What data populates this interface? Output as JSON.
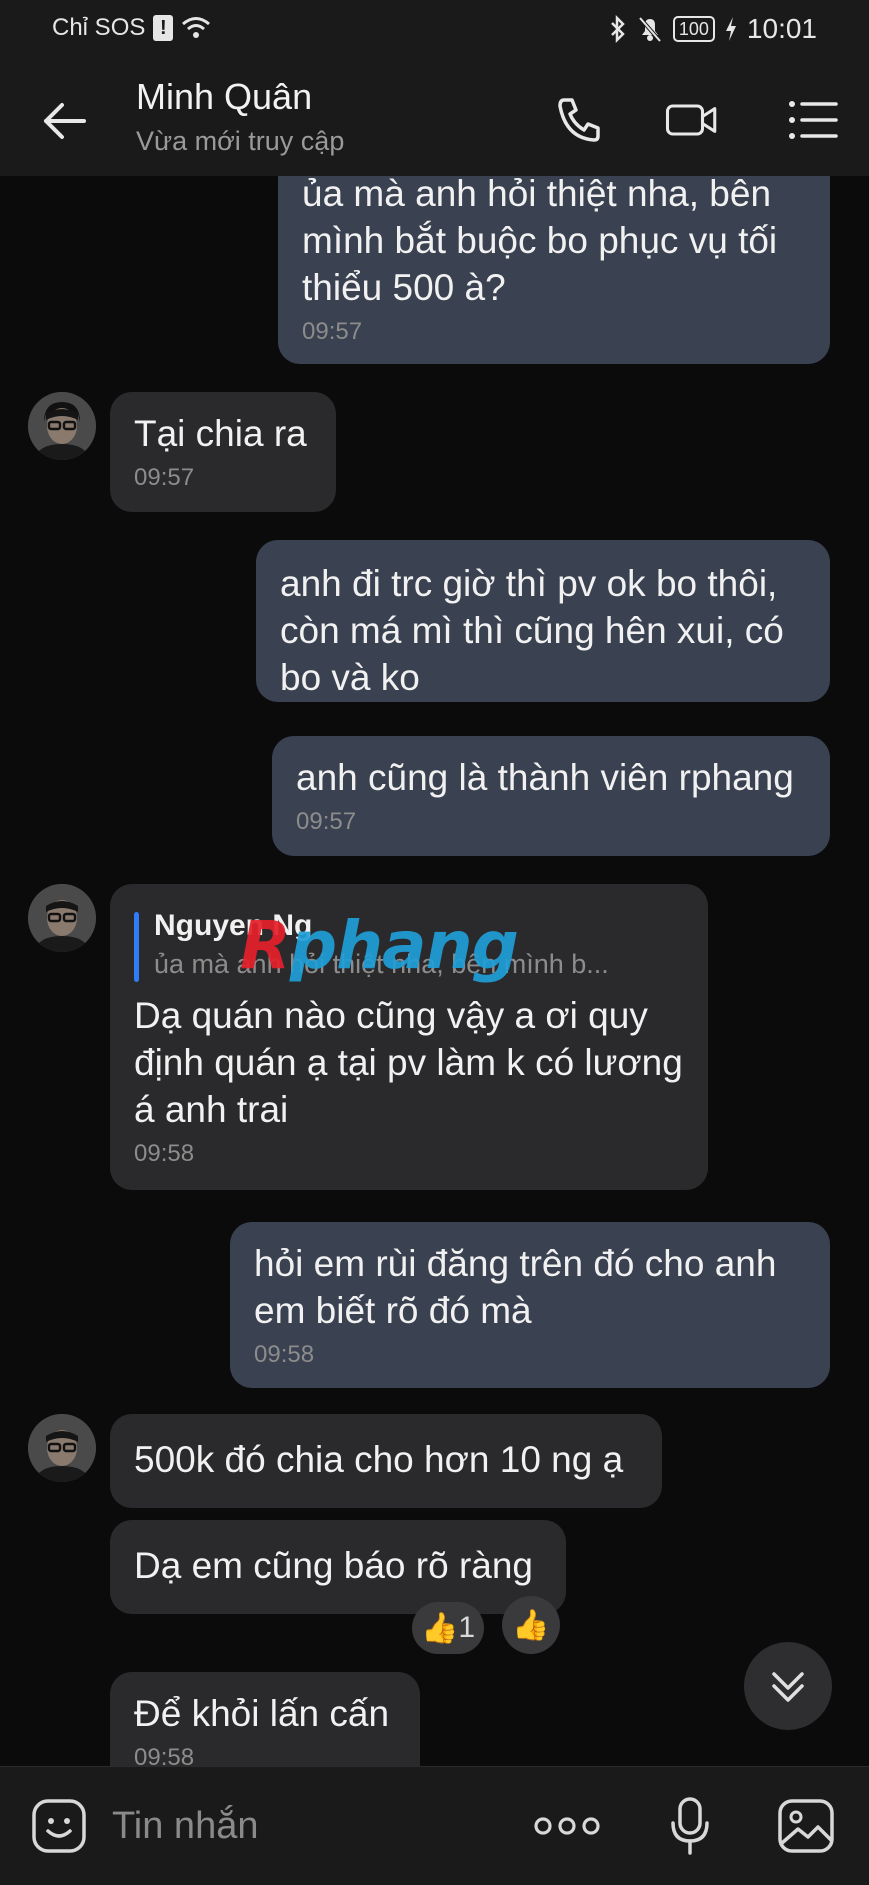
{
  "status_bar": {
    "carrier": "Chỉ SOS",
    "sos_mark": "!",
    "battery": "100",
    "time": "10:01"
  },
  "header": {
    "name": "Minh Quân",
    "status": "Vừa mới truy cập"
  },
  "messages": [
    {
      "dir": "out",
      "text": "ủa mà anh hỏi thiệt nha, bên mình bắt buộc bo phục vụ tối thiểu 500 à?",
      "time": "09:57"
    },
    {
      "dir": "in",
      "text": "Tại chia ra",
      "time": "09:57"
    },
    {
      "dir": "out",
      "text": "anh đi trc giờ thì pv ok bo thôi, còn má mì thì cũng hên xui, có bo và ko"
    },
    {
      "dir": "out",
      "text": "anh cũng là thành viên rphang",
      "time": "09:57"
    },
    {
      "dir": "in",
      "quote_name": "Nguyen Ng",
      "quote_text": "ủa mà anh hỏi thiệt nha, bên mình b...",
      "text": "Dạ quán nào cũng vậy a ơi quy định quán ạ tại pv làm k có lương á anh trai",
      "time": "09:58"
    },
    {
      "dir": "out",
      "text": "hỏi em rùi đăng trên đó cho anh em biết rõ đó mà",
      "time": "09:58"
    },
    {
      "dir": "in",
      "text": "500k đó chia cho hơn 10 ng ạ"
    },
    {
      "dir": "in",
      "text": "Dạ em cũng báo rõ ràng"
    },
    {
      "dir": "in",
      "text": "Để khỏi lấn cấn",
      "time": "09:58"
    }
  ],
  "reactions": [
    {
      "emoji": "👍",
      "count": "1"
    },
    {
      "emoji": "👍",
      "count": ""
    }
  ],
  "watermark": {
    "r": "R",
    "rest": "phang",
    "r_color": "#e5202a",
    "rest_color": "#1f9fd8"
  },
  "composer": {
    "placeholder": "Tin nhắn"
  },
  "colors": {
    "background": "#0b0b0c",
    "outgoing_bubble": "#3a4150",
    "incoming_bubble": "#2a2a2c",
    "quote_accent": "#2f7cf6"
  }
}
